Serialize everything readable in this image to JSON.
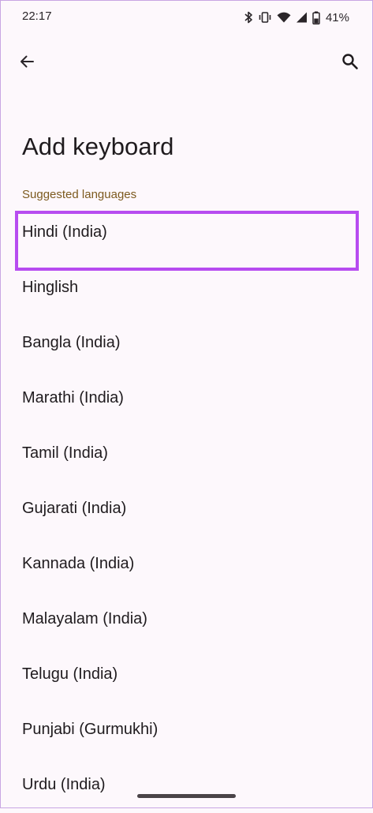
{
  "status_bar": {
    "time": "22:17",
    "battery_percent": "41%",
    "icons": [
      "bluetooth-icon",
      "vibrate-icon",
      "wifi-icon",
      "signal-icon",
      "battery-icon"
    ]
  },
  "toolbar": {
    "back_icon": "arrow-left-icon",
    "search_icon": "search-icon"
  },
  "page": {
    "title": "Add keyboard",
    "section_header": "Suggested languages"
  },
  "languages": [
    "Hindi (India)",
    "Hinglish",
    "Bangla (India)",
    "Marathi (India)",
    "Tamil (India)",
    "Gujarati (India)",
    "Kannada (India)",
    "Malayalam (India)",
    "Telugu (India)",
    "Punjabi (Gurmukhi)",
    "Urdu (India)"
  ],
  "colors": {
    "background": "#fdf8fc",
    "section_header": "#7d5a1f",
    "highlight": "#b74cf0",
    "text": "#1f1b1e"
  }
}
